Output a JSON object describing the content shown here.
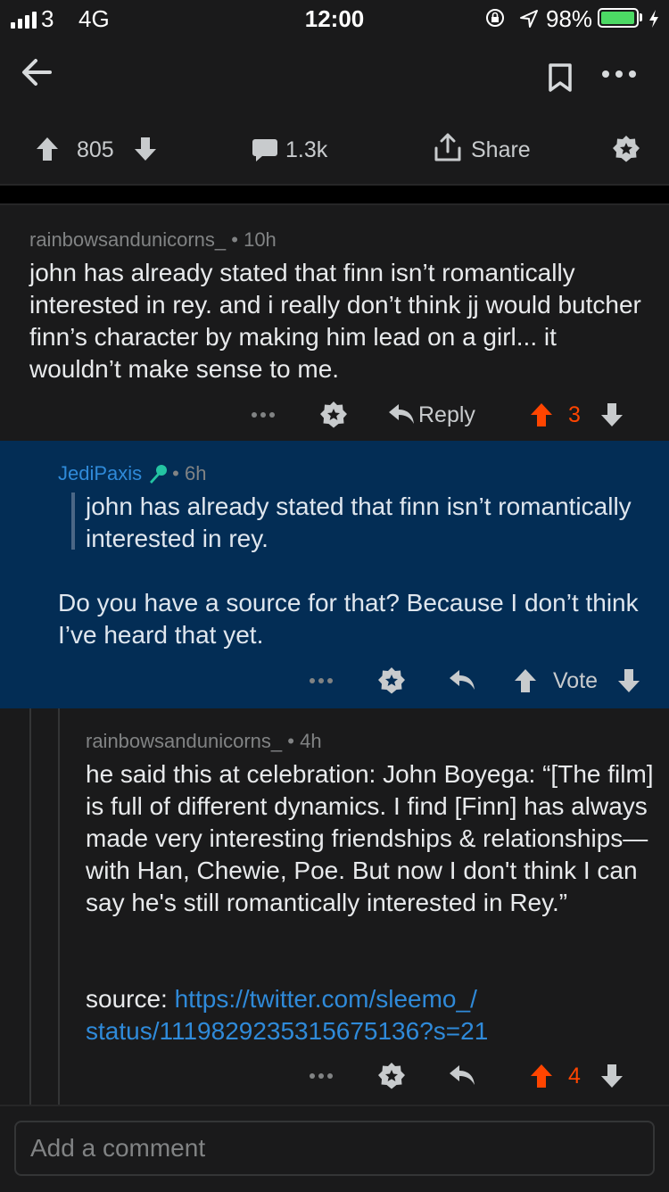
{
  "status_bar": {
    "carrier": "3",
    "network": "4G",
    "time": "12:00",
    "battery": "98%",
    "battery_level": 0.98,
    "battery_color": "#4cd964"
  },
  "nav": {
    "icons": [
      "back-arrow-icon",
      "bookmark-icon",
      "more-options-icon"
    ]
  },
  "action_bar": {
    "score": "805",
    "comments": "1.3k",
    "share": "Share"
  },
  "comments": [
    {
      "author": "rainbowsandunicorns_",
      "time": "• 10h",
      "body": "john has already stated that finn isn’t romantically interested in rey. and i really don’t think jj would butcher finn’s character by making him lead on a girl... it wouldn’t make sense to me.",
      "actions": {
        "reply": "Reply",
        "score": "3"
      }
    },
    {
      "author": "JediPaxis",
      "time": "• 6h",
      "quote": "john has already stated that finn isn’t romantically interested in rey.",
      "body": "Do you have a source for that? Because I don’t think I’ve heard that yet.",
      "actions": {
        "vote": "Vote"
      },
      "highlight_color": "#032d55"
    },
    {
      "author": "rainbowsandunicorns_",
      "time": "• 4h",
      "body": "he said this at celebration: John Boyega: “[The film] is full of different dynamics. I find [Finn] has always made very interesting friendships & relationships—with Han, Chewie, Poe. But now I don't think I can say he's still romantically interested in Rey.”",
      "source_label": "source:",
      "source_link_line1": "https://twitter.com/sleemo_/",
      "source_link_line2": "status/1119829235315675136?s=21",
      "actions": {
        "score": "4"
      }
    }
  ],
  "compose": {
    "placeholder": "Add a comment"
  },
  "colors": {
    "upvote": "#ff4500",
    "link": "#2f8ad9",
    "background": "#1a1a1b"
  }
}
